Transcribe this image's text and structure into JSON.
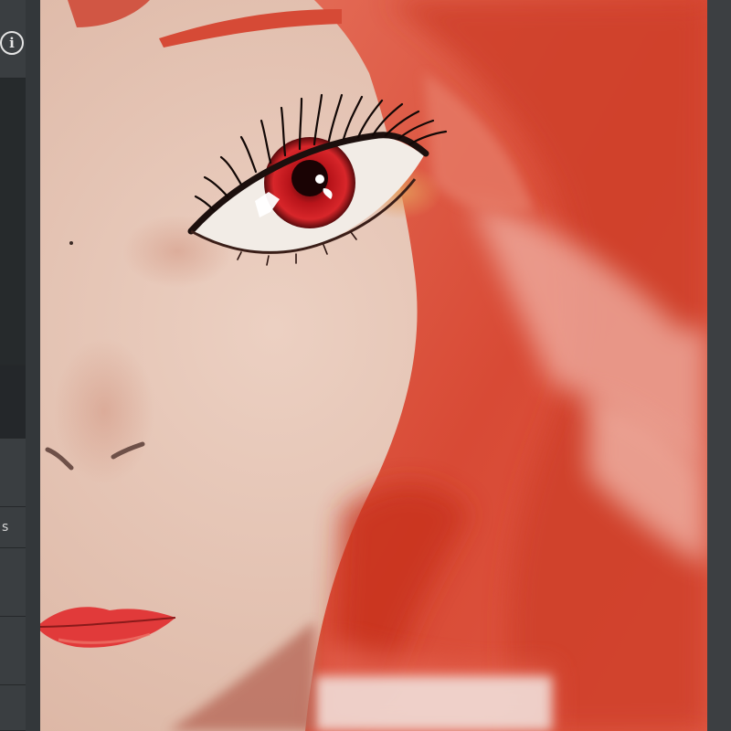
{
  "app": {
    "info_glyph": "i",
    "sidebar_partial_label": "s"
  },
  "colors": {
    "skin": "#e8c8b8",
    "hair": "#d9503c",
    "hair_dark": "#c23a25",
    "iris": "#c4161c",
    "lips": "#e13a3a",
    "sidebar": "#33373a"
  },
  "icons": [
    "info-icon"
  ]
}
